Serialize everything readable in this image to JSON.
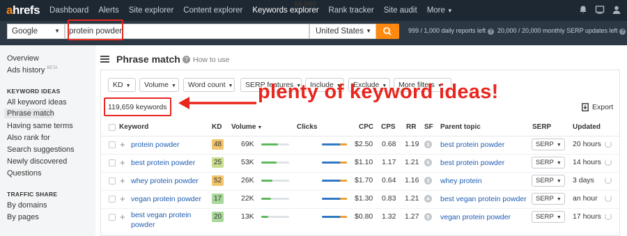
{
  "brand": {
    "logo_a": "a",
    "logo_rest": "hrefs"
  },
  "nav": {
    "items": [
      {
        "label": "Dashboard"
      },
      {
        "label": "Alerts"
      },
      {
        "label": "Site explorer"
      },
      {
        "label": "Content explorer"
      },
      {
        "label": "Keywords explorer"
      },
      {
        "label": "Rank tracker"
      },
      {
        "label": "Site audit"
      },
      {
        "label": "More"
      }
    ]
  },
  "search": {
    "engine": "Google",
    "query": "protein powder",
    "country": "United States",
    "daily_limit": "999 / 1,000 daily reports left",
    "serp_limit": "20,000 / 20,000 monthly SERP updates left"
  },
  "sidebar": {
    "overview": "Overview",
    "ads_history": "Ads history",
    "beta": "BETA",
    "keyword_ideas_header": "KEYWORD IDEAS",
    "ideas": [
      "All keyword ideas",
      "Phrase match",
      "Having same terms",
      "Also rank for",
      "Search suggestions",
      "Newly discovered",
      "Questions"
    ],
    "traffic_header": "TRAFFIC SHARE",
    "traffic": [
      "By domains",
      "By pages"
    ]
  },
  "main": {
    "title": "Phrase match",
    "how_to": "How to use",
    "filters": [
      "KD",
      "Volume",
      "Word count",
      "SERP features",
      "Include",
      "Exclude",
      "More filters"
    ],
    "keyword_count": "119,659 keywords",
    "export_label": "Export",
    "callout": "plenty of keyword ideas!",
    "columns": {
      "keyword": "Keyword",
      "kd": "KD",
      "volume": "Volume",
      "clicks": "Clicks",
      "cpc": "CPC",
      "cps": "CPS",
      "rr": "RR",
      "sf": "SF",
      "parent": "Parent topic",
      "serp": "SERP",
      "updated": "Updated"
    },
    "rows": [
      {
        "keyword": "protein powder",
        "kd": "48",
        "kd_color": "#f2c46b",
        "volume": "69K",
        "volume_fill": 0.6,
        "clicks": "46,866",
        "cpc": "$2.50",
        "cps": "0.68",
        "rr": "1.19",
        "sf": "3",
        "parent": "best protein powder",
        "serp": "SERP",
        "updated": "20 hours"
      },
      {
        "keyword": "best protein powder",
        "kd": "25",
        "kd_color": "#c8dd8e",
        "volume": "53K",
        "volume_fill": 0.55,
        "clicks": "61,546",
        "cpc": "$1.10",
        "cps": "1.17",
        "rr": "1.21",
        "sf": "5",
        "parent": "best protein powder",
        "serp": "SERP",
        "updated": "14 hours"
      },
      {
        "keyword": "whey protein powder",
        "kd": "52",
        "kd_color": "#f2c46b",
        "volume": "26K",
        "volume_fill": 0.4,
        "clicks": "16,960",
        "cpc": "$1.70",
        "cps": "0.64",
        "rr": "1.16",
        "sf": "3",
        "parent": "whey protein",
        "serp": "SERP",
        "updated": "3 days"
      },
      {
        "keyword": "vegan protein powder",
        "kd": "17",
        "kd_color": "#a9d89b",
        "volume": "22K",
        "volume_fill": 0.35,
        "clicks": "18,605",
        "cpc": "$1.30",
        "cps": "0.83",
        "rr": "1.21",
        "sf": "4",
        "parent": "best vegan protein powder",
        "serp": "SERP",
        "updated": "an hour"
      },
      {
        "keyword": "best vegan protein powder",
        "kd": "20",
        "kd_color": "#a9d89b",
        "volume": "13K",
        "volume_fill": 0.25,
        "clicks": "16,649",
        "cpc": "$0.80",
        "cps": "1.32",
        "rr": "1.27",
        "sf": "5",
        "parent": "vegan protein powder",
        "serp": "SERP",
        "updated": "17 hours"
      }
    ]
  },
  "colors": {
    "accent": "#ff8a0f",
    "link": "#1f5db3",
    "highlight": "#e8261e",
    "nav_bg": "#1e2832"
  }
}
